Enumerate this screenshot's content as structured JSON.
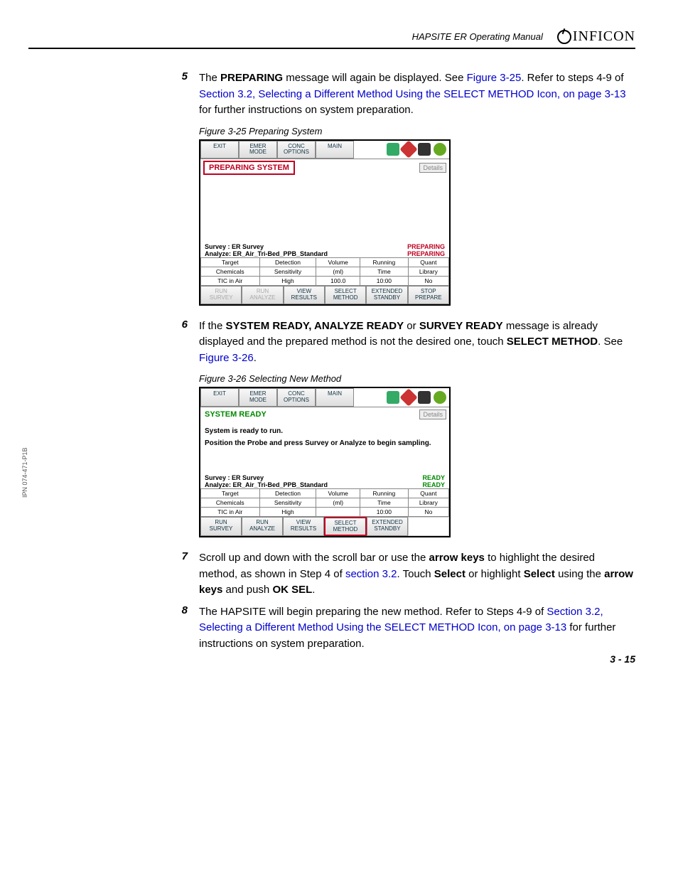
{
  "header": {
    "manual_title": "HAPSITE ER Operating Manual",
    "brand": "INFICON"
  },
  "steps": {
    "s5": {
      "num": "5",
      "t1": "The ",
      "b1": "PREPARING",
      "t2": " message will again be displayed. See ",
      "l1": "Figure 3-25",
      "t3": ". Refer to steps 4-9 of ",
      "l2": "Section 3.2, Selecting a Different Method Using the SELECT METHOD Icon, on page 3-13",
      "t4": " for further instructions on system preparation."
    },
    "s6": {
      "num": "6",
      "t1": "If the ",
      "b1": "SYSTEM READY, ANALYZE READY",
      "t2": " or ",
      "b2": "SURVEY READY",
      "t3": " message is already displayed and the prepared method is not the desired one, touch ",
      "b3": "SELECT METHOD",
      "t4": ". See ",
      "l1": "Figure 3-26",
      "t5": "."
    },
    "s7": {
      "num": "7",
      "t1": "Scroll up and down with the scroll bar or use the ",
      "b1": "arrow keys",
      "t2": " to highlight the desired method, as shown in Step 4 of ",
      "l1": "section 3.2",
      "t3": ". Touch ",
      "b2": "Select",
      "t4": " or highlight ",
      "b3": "Select",
      "t5": " using the ",
      "b4": "arrow keys",
      "t6": " and push ",
      "b5": "OK SEL",
      "t7": "."
    },
    "s8": {
      "num": "8",
      "t1": "The HAPSITE will begin preparing the new method. Refer to Steps 4-9 of ",
      "l1": "Section 3.2, Selecting a Different Method Using the SELECT METHOD Icon, on page 3-13",
      "t2": " for further instructions on system preparation."
    }
  },
  "fig25": {
    "caption": "Figure 3-25  Preparing System",
    "top": {
      "exit": "EXIT",
      "emer": "EMER\nMODE",
      "conc": "CONC\nOPTIONS",
      "main": "MAIN"
    },
    "status": "PREPARING SYSTEM",
    "details": "Details",
    "survey_label": "Survey : ER Survey",
    "analyze_label": "Analyze: ER_Air_Tri-Bed_PPB_Standard",
    "right_status1": "PREPARING",
    "right_status2": "PREPARING",
    "table": {
      "h": [
        "Target",
        "Detection",
        "Volume",
        "Running",
        "Quant"
      ],
      "r1": [
        "Chemicals",
        "Sensitivity",
        "(ml)",
        "Time",
        "Library"
      ],
      "r2": [
        "TIC in Air",
        "High",
        "100.0",
        "10:00",
        "No"
      ]
    },
    "bottom": [
      "RUN\nSURVEY",
      "RUN\nANALYZE",
      "VIEW\nRESULTS",
      "SELECT\nMETHOD",
      "EXTENDED\nSTANDBY",
      "STOP\nPREPARE"
    ]
  },
  "fig26": {
    "caption": "Figure 3-26  Selecting New Method",
    "top": {
      "exit": "EXIT",
      "emer": "EMER\nMODE",
      "conc": "CONC\nOPTIONS",
      "main": "MAIN"
    },
    "status": "SYSTEM READY",
    "details": "Details",
    "msg1": "System is ready to run.",
    "msg2": "Position the Probe and press Survey or Analyze to begin sampling.",
    "survey_label": "Survey : ER Survey",
    "analyze_label": "Analyze: ER_Air_Tri-Bed_PPB_Standard",
    "right_status1": "READY",
    "right_status2": "READY",
    "table": {
      "h": [
        "Target",
        "Detection",
        "Volume",
        "Running",
        "Quant"
      ],
      "r1": [
        "Chemicals",
        "Sensitivity",
        "(ml)",
        "Time",
        "Library"
      ],
      "r2": [
        "TIC in Air",
        "High",
        "",
        "10:00",
        "No"
      ]
    },
    "bottom": [
      "RUN\nSURVEY",
      "RUN\nANALYZE",
      "VIEW\nRESULTS",
      "SELECT\nMETHOD",
      "EXTENDED\nSTANDBY",
      ""
    ]
  },
  "page_number": "3 - 15",
  "side_label": "IPN 074-471-P1B"
}
